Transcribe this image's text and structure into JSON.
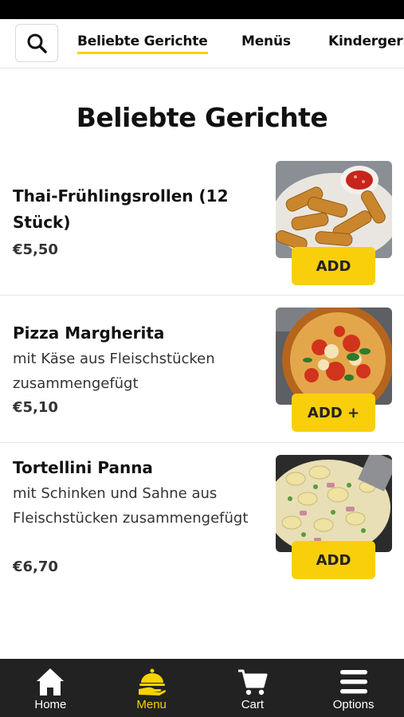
{
  "top_nav": {
    "tabs": [
      {
        "label": "Beliebte Gerichte",
        "active": true
      },
      {
        "label": "Menüs",
        "active": false
      },
      {
        "label": "Kindergeri",
        "active": false
      }
    ]
  },
  "page_title": "Beliebte Gerichte",
  "items": [
    {
      "name": "Thai-Frühlingsrollen (12 Stück)",
      "description": "",
      "price": "€5,50",
      "button_label": "ADD",
      "image_icon": "spring-rolls-image"
    },
    {
      "name": "Pizza Margherita",
      "description": "mit Käse aus Fleischstücken zusammengefügt",
      "price": "€5,10",
      "button_label": "ADD +",
      "image_icon": "pizza-image"
    },
    {
      "name": "Tortellini Panna",
      "description": "mit Schinken und Sahne aus Fleischstücken zusammengefügt",
      "price": "€6,70",
      "button_label": "ADD",
      "image_icon": "tortellini-image"
    }
  ],
  "bottom_nav": [
    {
      "label": "Home",
      "icon": "home-icon",
      "active": false
    },
    {
      "label": "Menu",
      "icon": "menu-cloche-icon",
      "active": true
    },
    {
      "label": "Cart",
      "icon": "cart-icon",
      "active": false
    },
    {
      "label": "Options",
      "icon": "options-icon",
      "active": false
    }
  ],
  "colors": {
    "accent_yellow": "#f9cf0c",
    "bottom_bar": "#222222",
    "active_tab_underline": "#f5d400"
  }
}
